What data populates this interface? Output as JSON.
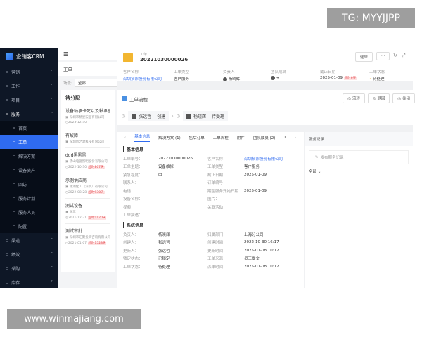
{
  "watermarks": {
    "top": "TG: MYYJJPP",
    "bottom": "www.winmajiang.com"
  },
  "brand": "企销客CRM",
  "sidebar": {
    "items": [
      {
        "label": "营销",
        "icon": "marketing-icon"
      },
      {
        "label": "工作",
        "icon": "work-icon"
      },
      {
        "label": "项目",
        "icon": "project-icon"
      },
      {
        "label": "服务",
        "icon": "headset-icon",
        "open": true
      },
      {
        "label": "渠道",
        "icon": "channel-icon"
      },
      {
        "label": "绩效",
        "icon": "trophy-icon"
      },
      {
        "label": "采购",
        "icon": "cart-icon"
      },
      {
        "label": "库存",
        "icon": "inventory-icon"
      }
    ],
    "sub": [
      {
        "label": "首页"
      },
      {
        "label": "工单",
        "active": true
      },
      {
        "label": "解决方案"
      },
      {
        "label": "设备资产"
      },
      {
        "label": "回访"
      },
      {
        "label": "服务计划"
      },
      {
        "label": "服务人员"
      },
      {
        "label": "配置"
      }
    ]
  },
  "list": {
    "title": "工单",
    "scene_label": "场景:",
    "scene_value": "全部",
    "group": "待分配",
    "items": [
      {
        "title": "设备轴承卡死以及轴承座的",
        "company": "深圳市精星实业有限公司",
        "date": "2023-12-30",
        "overdue": ""
      },
      {
        "title": "有故障",
        "company": "深圳创之源科技有限公司",
        "date": "",
        "overdue": ""
      },
      {
        "title": "ddd黑黑黑",
        "company": "佛山电器照明股份有限公司",
        "date": "2022-10-30",
        "overdue": "超时807天"
      },
      {
        "title": "示例供应商",
        "company": "锦湖化工（深圳）有限公司",
        "date": "2022-08-28",
        "overdue": "超时930天"
      },
      {
        "title": "测试设备",
        "company": "张三",
        "date": "2021-12-31",
        "overdue": "超时1170天"
      },
      {
        "title": "测试审批",
        "company": "深圳市汇聚投资咨询有限公司",
        "date": "2021-01-07",
        "overdue": "超时1528天"
      }
    ]
  },
  "header": {
    "type": "工单",
    "number": "20221030000026",
    "urge": "催单",
    "more": "···",
    "fields": [
      {
        "k": "客户名称",
        "v": "深圳拓邦股份有限公司",
        "link": true
      },
      {
        "k": "工单类型",
        "v": "客户服务"
      },
      {
        "k": "负责人",
        "v": "杨晓辉"
      },
      {
        "k": "团队成员",
        "v": "+"
      },
      {
        "k": "截止日期",
        "v": "2025-01-09",
        "badge": "超时6天"
      },
      {
        "k": "工单状态",
        "v": "待处理"
      }
    ]
  },
  "flow": {
    "title": "工单流程",
    "buttons": [
      "流转",
      "退回",
      "关闭"
    ],
    "steps": [
      {
        "name": "张远哲",
        "state": "创建"
      },
      {
        "name": "杨晓辉",
        "state": "待受理"
      }
    ]
  },
  "tabs": [
    "基本信息",
    "解决方案 (1)",
    "售后订单",
    "工单流程",
    "附件",
    "团队成员 (2)",
    "1"
  ],
  "basic": {
    "title": "基本信息",
    "rows": [
      [
        "工单编号：",
        "20221030000026",
        "客户名称：",
        "深圳拓邦股份有限公司"
      ],
      [
        "工单主题：",
        "设备维修",
        "工单类型：",
        "客户服务"
      ],
      [
        "紧急程度：",
        "中",
        "截止日期：",
        "2025-01-09"
      ],
      [
        "联系人：",
        "",
        "订单编号：",
        ""
      ],
      [
        "电话：",
        "",
        "期望服务开始日期：",
        "2025-01-09"
      ],
      [
        "设备名称：",
        "",
        "图片：",
        ""
      ],
      [
        "视频：",
        "",
        "关联活动：",
        ""
      ],
      [
        "工单描述：",
        "",
        "",
        ""
      ]
    ]
  },
  "system": {
    "title": "系统信息",
    "rows": [
      [
        "负责人：",
        "杨晓辉",
        "归属部门：",
        "上海分公司"
      ],
      [
        "创建人：",
        "张远哲",
        "创建时间：",
        "2022-10-30 16:17"
      ],
      [
        "更新人：",
        "张远哲",
        "更新时间：",
        "2025-01-08 10:12"
      ],
      [
        "锁定状态：",
        "已锁定",
        "工单来源：",
        "员工提交"
      ],
      [
        "工单状态：",
        "待处理",
        "派单时间：",
        "2025-01-08 10:12"
      ]
    ]
  },
  "records": {
    "title": "服务记录",
    "publish": "发布服务记录",
    "filter": "全部"
  },
  "colors": {
    "sidebar": "#0e1726",
    "accent": "#2f6bf0",
    "overdue": "#e5484d",
    "icon_bg": "#f2b630"
  }
}
